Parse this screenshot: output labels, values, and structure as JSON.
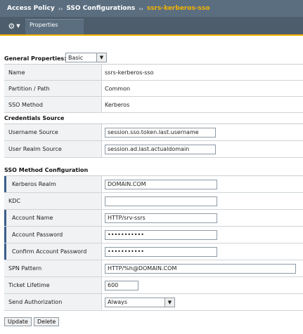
{
  "breadcrumb": {
    "items": [
      "Access Policy",
      "SSO Configurations",
      "ssrs-kerberos-sso"
    ],
    "sep": "››"
  },
  "toolbar": {
    "gear_icon": "gear-icon",
    "properties_tab": "Properties"
  },
  "general": {
    "title": "General Properties:",
    "mode_select": "Basic",
    "rows": [
      {
        "label": "Name",
        "value": "ssrs-kerberos-sso"
      },
      {
        "label": "Partition / Path",
        "value": "Common"
      },
      {
        "label": "SSO Method",
        "value": "Kerberos"
      }
    ]
  },
  "credentials": {
    "title": "Credentials Source",
    "rows": [
      {
        "label": "Username Source",
        "value": "session.sso.token.last.username"
      },
      {
        "label": "User Realm Source",
        "value": "session.ad.last.actualdomain"
      }
    ]
  },
  "sso_method": {
    "title": "SSO Method Configuration",
    "rows": [
      {
        "label": "Kerberos Realm",
        "value": "DOMAIN.COM"
      },
      {
        "label": "KDC",
        "value": ""
      },
      {
        "label": "Account Name",
        "value": "HTTP/srv-ssrs"
      },
      {
        "label": "Account Password",
        "value": "•••••••••••"
      },
      {
        "label": "Confirm Account Password",
        "value": "•••••••••••"
      },
      {
        "label": "SPN Pattern",
        "value": "HTTP/%h@DOMAIN.COM"
      },
      {
        "label": "Ticket Lifetime",
        "value": "600"
      },
      {
        "label": "Send Authorization",
        "value": "Always"
      }
    ]
  },
  "buttons": {
    "update": "Update",
    "delete": "Delete"
  }
}
